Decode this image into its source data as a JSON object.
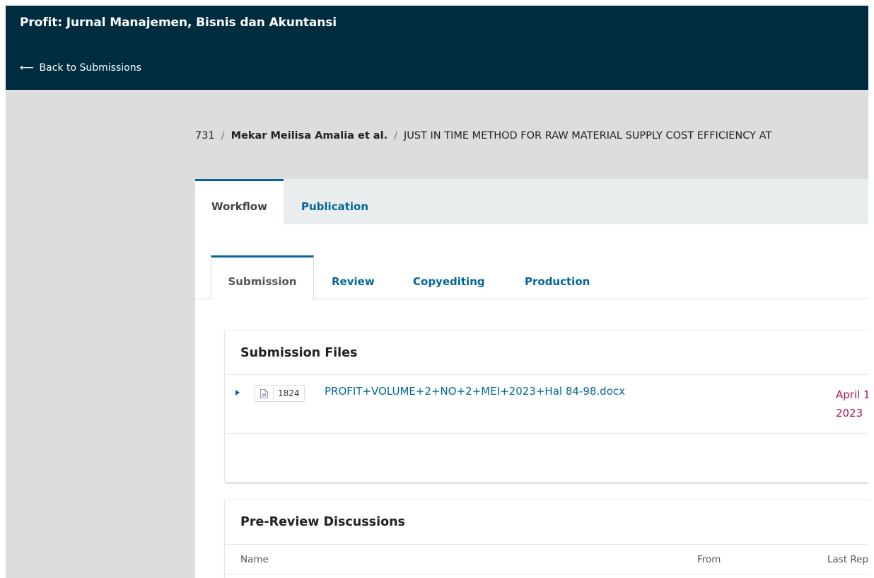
{
  "header": {
    "site_title": "Profit: Jurnal Manajemen, Bisnis dan Akuntansi",
    "back_arrow": "⟵",
    "back_label": "Back to Submissions"
  },
  "breadcrumb": {
    "id": "731",
    "separator": "/",
    "authors": "Mekar Meilisa Amalia et al.",
    "title": "JUST IN TIME METHOD FOR RAW MATERIAL SUPPLY COST EFFICIENCY AT"
  },
  "main_tabs": [
    {
      "label": "Workflow",
      "active": true
    },
    {
      "label": "Publication",
      "active": false
    }
  ],
  "stage_tabs": [
    {
      "label": "Submission",
      "active": true
    },
    {
      "label": "Review",
      "active": false
    },
    {
      "label": "Copyediting",
      "active": false
    },
    {
      "label": "Production",
      "active": false
    }
  ],
  "submission_files": {
    "title": "Submission Files",
    "files": [
      {
        "id": "1824",
        "icon": "word-document-icon",
        "name": "PROFIT+VOLUME+2+NO+2+MEI+2023+Hal 84-98.docx",
        "date_line1": "April 1",
        "date_line2": "2023"
      }
    ]
  },
  "discussions": {
    "title": "Pre-Review Discussions",
    "columns": [
      "Name",
      "From",
      "Last Rep"
    ]
  },
  "colors": {
    "header_bg": "#002c40",
    "link": "#006798",
    "date": "#a0185c"
  }
}
